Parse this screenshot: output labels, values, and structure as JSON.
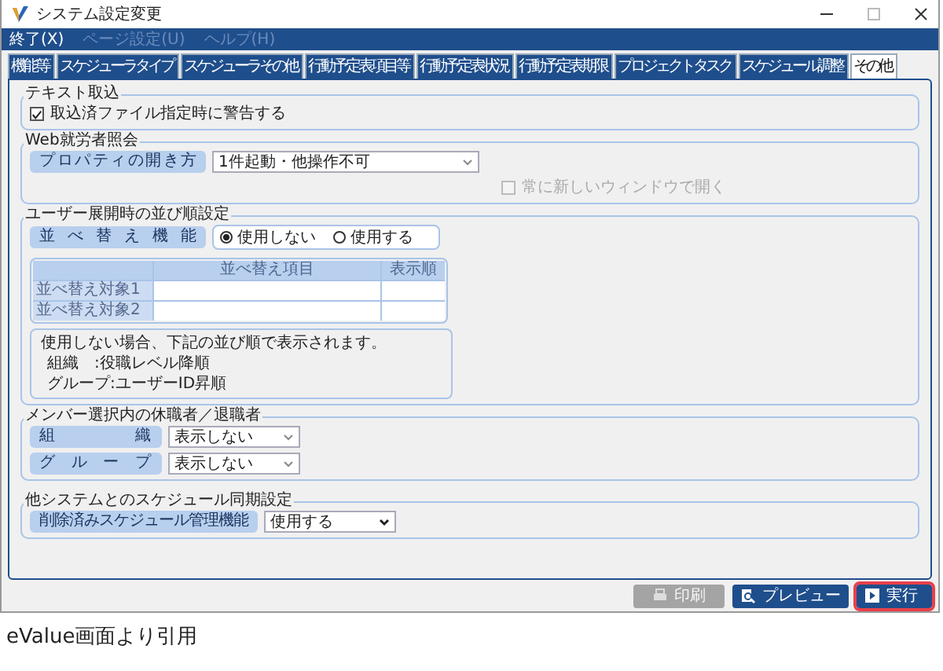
{
  "window": {
    "title": "システム設定変更"
  },
  "menu": [
    {
      "label": "終了(X)",
      "disabled": false
    },
    {
      "label": "ページ設定(U)",
      "disabled": true
    },
    {
      "label": "ヘルプ(H)",
      "disabled": true
    }
  ],
  "tabs": [
    {
      "label": "機能等",
      "selected": false
    },
    {
      "label": "スケジューラタイプ",
      "selected": false
    },
    {
      "label": "スケジューラその他",
      "selected": false
    },
    {
      "label": "行動予定表項目等",
      "selected": false
    },
    {
      "label": "行動予定表状況",
      "selected": false
    },
    {
      "label": "行動予定表期限",
      "selected": false
    },
    {
      "label": "プロジェクトタスク",
      "selected": false
    },
    {
      "label": "スケジュール調整",
      "selected": false
    },
    {
      "label": "その他",
      "selected": true
    }
  ],
  "text_import": {
    "title": "テキスト取込",
    "checkbox": {
      "label": "取込済ファイル指定時に警告する",
      "checked": true,
      "disabled": false
    }
  },
  "web_inquiry": {
    "title": "Web就労者照会",
    "property_label": "プロパティの開き方",
    "property_value": "1件起動・他操作不可",
    "new_window": {
      "label": "常に新しいウィンドウで開く",
      "checked": false,
      "disabled": true
    }
  },
  "sort_settings": {
    "title": "ユーザー展開時の並び順設定",
    "label": "並べ替え機能",
    "radios": [
      {
        "label": "使用しない",
        "selected": true
      },
      {
        "label": "使用する",
        "selected": false
      }
    ],
    "table": {
      "columns": [
        "並べ替え項目",
        "表示順"
      ],
      "rows": [
        "並べ替え対象1",
        "並べ替え対象2"
      ]
    },
    "note": {
      "text": "使用しない場合、下記の並び順で表示されます。",
      "lines": [
        "組織　:役職レベル降順",
        "グループ:ユーザーID昇順"
      ]
    }
  },
  "members": {
    "title": "メンバー選択内の休職者／退職者",
    "rows": [
      {
        "label": "組織",
        "value": "表示しない"
      },
      {
        "label": "グループ",
        "value": "表示しない"
      }
    ]
  },
  "sync": {
    "title": "他システムとのスケジュール同期設定",
    "rows": [
      {
        "label": "削除済みスケジュール管理機能",
        "value": "使用する"
      }
    ]
  },
  "buttons": [
    {
      "kind": "print",
      "label": "印刷",
      "disabled": true,
      "highlighted": false
    },
    {
      "kind": "preview",
      "label": "プレビュー",
      "disabled": false,
      "highlighted": false
    },
    {
      "kind": "run",
      "label": "実行",
      "disabled": false,
      "highlighted": true
    }
  ],
  "caption": "eValue画面より引用"
}
